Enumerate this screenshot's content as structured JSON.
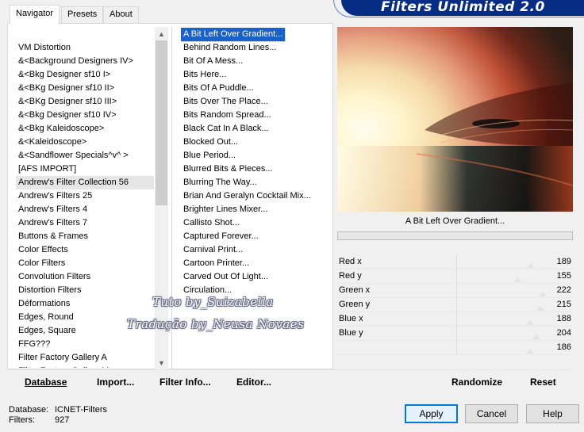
{
  "app": {
    "title": "Filters Unlimited 2.0"
  },
  "tabs": [
    {
      "label": "Navigator",
      "active": true
    },
    {
      "label": "Presets",
      "active": false
    },
    {
      "label": "About",
      "active": false
    }
  ],
  "categories": {
    "items": [
      "VM Distortion",
      "&<Background Designers IV>",
      "&<Bkg Designer sf10 I>",
      "&<BKg Designer sf10 II>",
      "&<BKg Designer sf10 III>",
      "&<Bkg Designer sf10 IV>",
      "&<Bkg Kaleidoscope>",
      "&<Kaleidoscope>",
      "&<Sandflower Specials^v^ >",
      "[AFS IMPORT]",
      "Andrew's Filter Collection 56",
      "Andrew's Filters 25",
      "Andrew's Filters 4",
      "Andrew's Filters 7",
      "Buttons & Frames",
      "Color Effects",
      "Color Filters",
      "Convolution Filters",
      "Distortion Filters",
      "Déformations",
      "Edges, Round",
      "Edges, Square",
      "FFG???",
      "Filter Factory Gallery A",
      "Filter Factory Gallery M"
    ],
    "selected": "Andrew's Filter Collection 56"
  },
  "filters": {
    "items": [
      "A Bit Left Over Gradient...",
      "Behind Random Lines...",
      "Bit Of A Mess...",
      "Bits Here...",
      "Bits Of A Puddle...",
      "Bits Over The Place...",
      "Bits Random Spread...",
      "Black Cat In A Black...",
      "Blocked Out...",
      "Blue Period...",
      "Blurred Bits & Pieces...",
      "Blurring The Way...",
      "Brian And Geralyn Cocktail Mix...",
      "Brighter Lines Mixer...",
      "Callisto Shot...",
      "Captured Forever...",
      "Carnival Print...",
      "Cartoon Printer...",
      "Carved Out Of Light...",
      "Circulation..."
    ],
    "selected": "A Bit Left Over Gradient..."
  },
  "preview": {
    "caption": "A Bit Left Over Gradient..."
  },
  "params": [
    {
      "label": "Red x",
      "value": "189",
      "level": 189
    },
    {
      "label": "Red y",
      "value": "155",
      "level": 155
    },
    {
      "label": "Green x",
      "value": "222",
      "level": 222
    },
    {
      "label": "Green y",
      "value": "215",
      "level": 215
    },
    {
      "label": "Blue x",
      "value": "188",
      "level": 188
    },
    {
      "label": "Blue y",
      "value": "204",
      "level": 204
    },
    {
      "label": "",
      "value": "186",
      "level": 186
    }
  ],
  "toolbar": {
    "database": "Database",
    "import": "Import...",
    "filter_info": "Filter Info...",
    "editor": "Editor...",
    "randomize": "Randomize",
    "reset": "Reset"
  },
  "info": {
    "database_label": "Database:",
    "database_value": "ICNET-Filters",
    "filters_label": "Filters:",
    "filters_value": "927"
  },
  "buttons": {
    "apply": "Apply",
    "cancel": "Cancel",
    "help": "Help"
  },
  "watermark": {
    "line1": "Tuto by_Suizabella",
    "line2": "Tradução by_Neusa Novaes"
  }
}
